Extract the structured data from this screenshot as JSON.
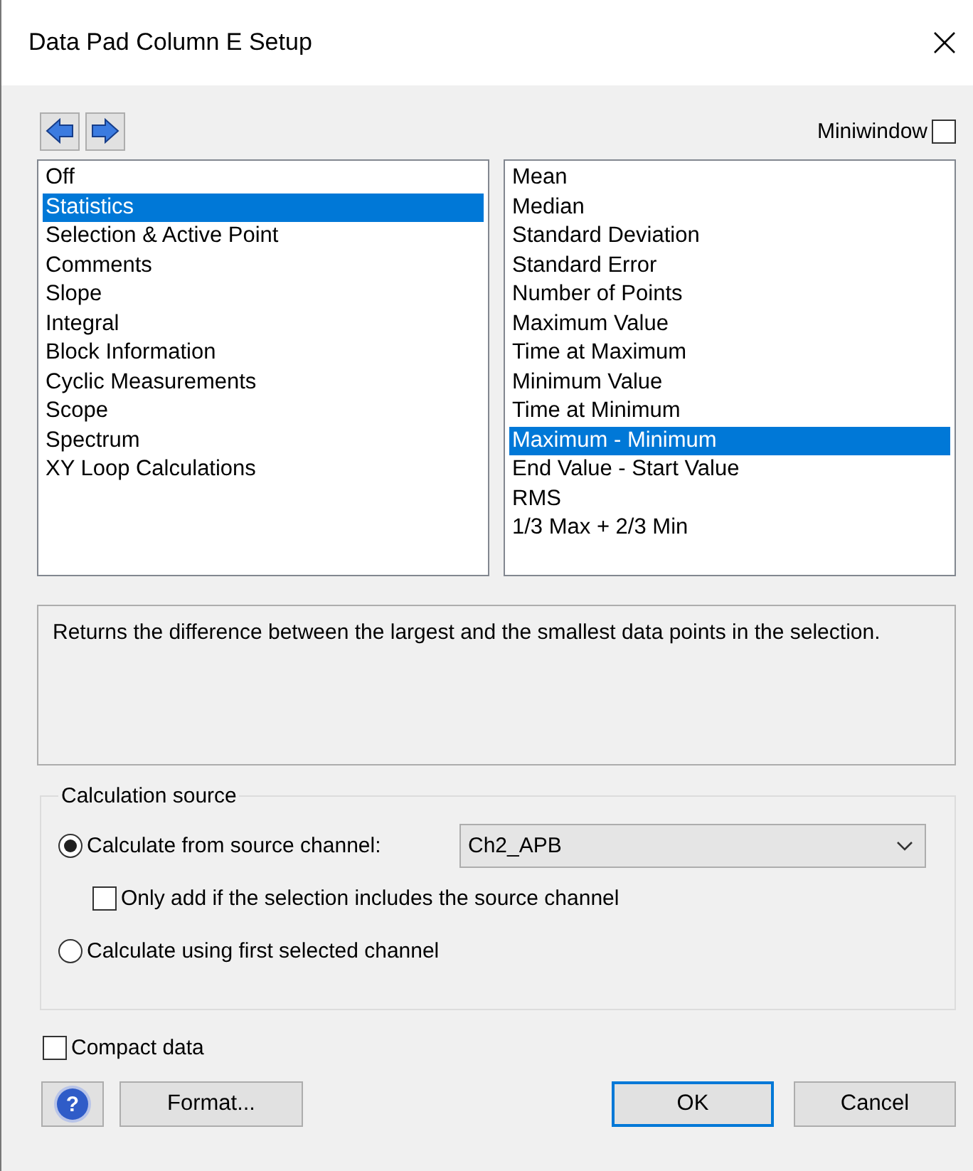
{
  "window": {
    "title": "Data Pad Column E Setup"
  },
  "miniwindow": {
    "label": "Miniwindow",
    "checked": false
  },
  "categories": [
    {
      "label": "Off",
      "selected": false
    },
    {
      "label": "Statistics",
      "selected": true
    },
    {
      "label": "Selection & Active Point",
      "selected": false
    },
    {
      "label": "Comments",
      "selected": false
    },
    {
      "label": "Slope",
      "selected": false
    },
    {
      "label": "Integral",
      "selected": false
    },
    {
      "label": "Block Information",
      "selected": false
    },
    {
      "label": "Cyclic Measurements",
      "selected": false
    },
    {
      "label": "Scope",
      "selected": false
    },
    {
      "label": "Spectrum",
      "selected": false
    },
    {
      "label": "XY Loop Calculations",
      "selected": false
    }
  ],
  "measurements": [
    {
      "label": "Mean",
      "selected": false
    },
    {
      "label": "Median",
      "selected": false
    },
    {
      "label": "Standard Deviation",
      "selected": false
    },
    {
      "label": "Standard Error",
      "selected": false
    },
    {
      "label": "Number of Points",
      "selected": false
    },
    {
      "label": "Maximum Value",
      "selected": false
    },
    {
      "label": "Time at Maximum",
      "selected": false
    },
    {
      "label": "Minimum Value",
      "selected": false
    },
    {
      "label": "Time at Minimum",
      "selected": false
    },
    {
      "label": "Maximum - Minimum",
      "selected": true
    },
    {
      "label": "End Value - Start Value",
      "selected": false
    },
    {
      "label": "RMS",
      "selected": false
    },
    {
      "label": "1/3 Max + 2/3 Min",
      "selected": false
    }
  ],
  "description": "Returns the difference between the largest and the smallest data points in the selection.",
  "calculation_source": {
    "title": "Calculation source",
    "options": [
      {
        "kind": "radio",
        "label": "Calculate from source channel:",
        "selected": true,
        "dropdown": "Ch2_APB"
      },
      {
        "kind": "checkbox",
        "label": "Only add if the selection includes the source channel",
        "checked": false
      },
      {
        "kind": "radio",
        "label": "Calculate using first selected channel",
        "selected": false
      }
    ]
  },
  "compact_data": {
    "label": "Compact data",
    "checked": false
  },
  "buttons": {
    "help": "?",
    "format": "Format...",
    "ok": {
      "label": "OK",
      "default": true
    },
    "cancel": "Cancel"
  }
}
